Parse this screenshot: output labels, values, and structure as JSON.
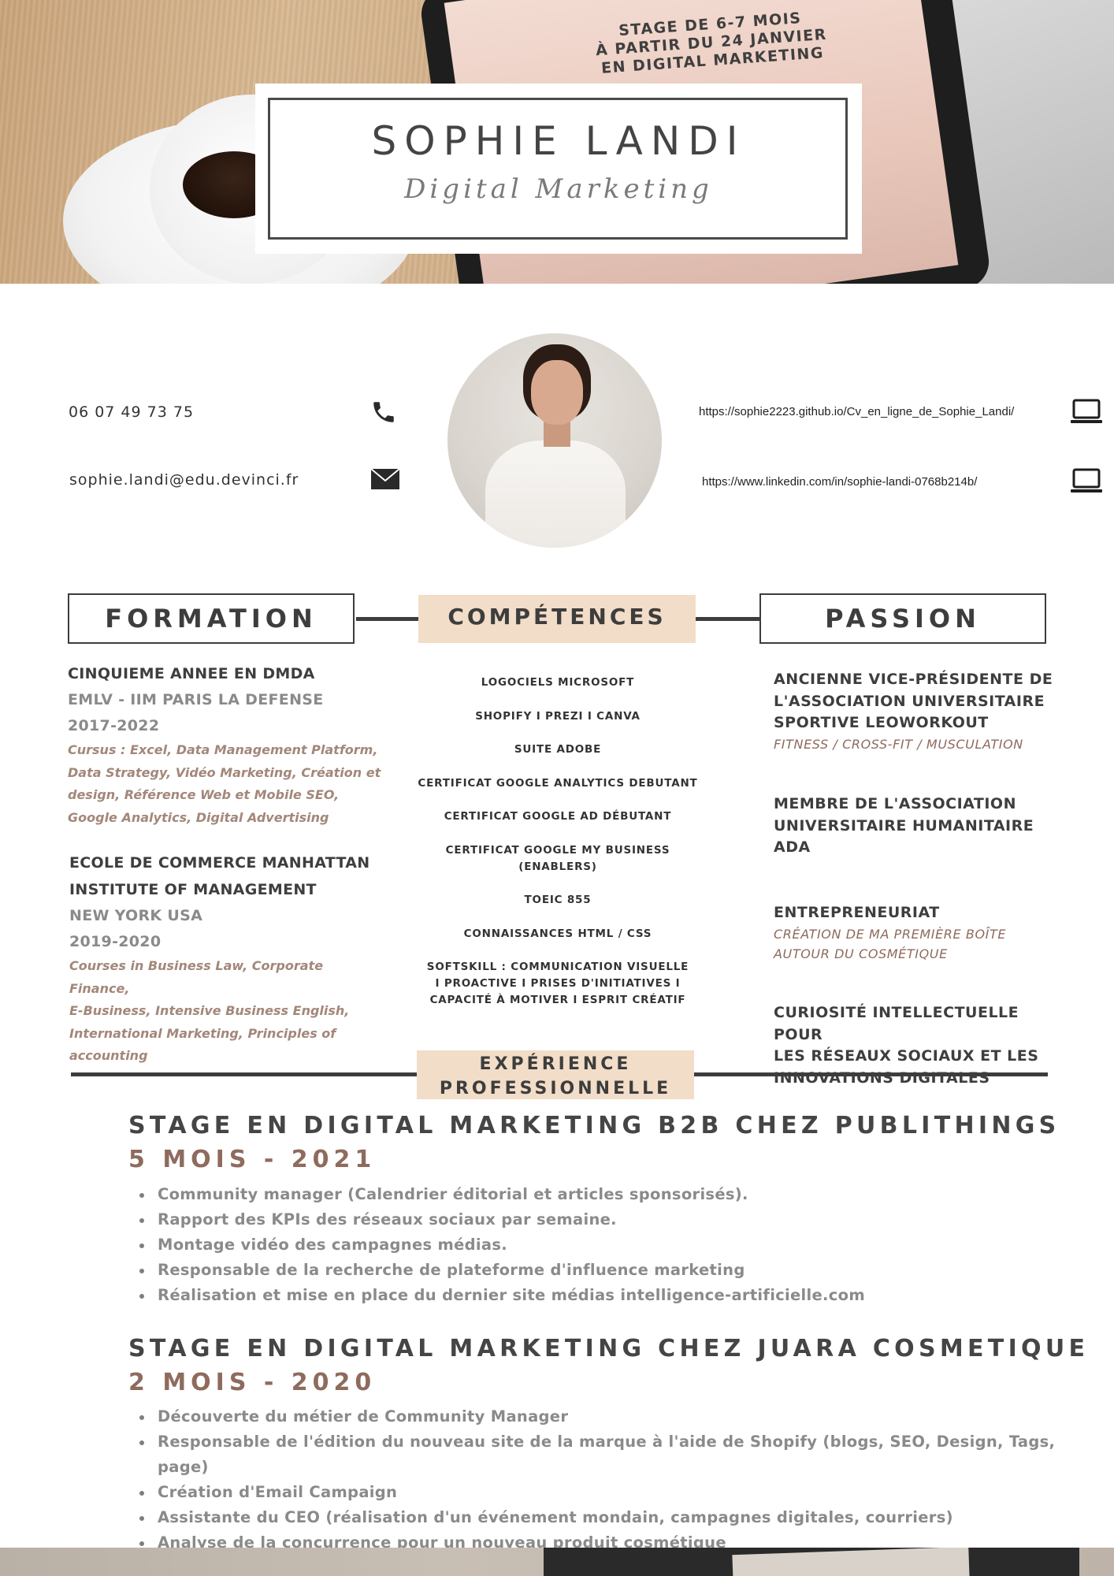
{
  "header": {
    "name": "SOPHIE LANDI",
    "title": "Digital Marketing",
    "stage_note": [
      "STAGE DE 6-7 MOIS",
      "À PARTIR DU 24 JANVIER",
      "EN DIGITAL MARKETING"
    ]
  },
  "contact": {
    "phone": "06 07 49 73 75",
    "email": "sophie.landi@edu.devinci.fr",
    "website": "https://sophie2223.github.io/Cv_en_ligne_de_Sophie_Landi/",
    "linkedin": "https://www.linkedin.com/in/sophie-landi-0768b214b/",
    "icons": {
      "phone": "phone-icon",
      "email": "envelope-icon",
      "website": "laptop-icon",
      "linkedin": "laptop-icon"
    }
  },
  "sections": {
    "formation": "FORMATION",
    "competences": "COMPÉTENCES",
    "passion": "PASSION",
    "experience": [
      "EXPÉRIENCE",
      "PROFESSIONNELLE"
    ]
  },
  "formation": [
    {
      "degree": "CINQUIEME ANNEE EN DMDA",
      "school": "EMLV - IIM PARIS LA DEFENSE",
      "years": "2017-2022",
      "desc": [
        "Cursus : Excel, Data Management Platform,",
        "Data Strategy, Vidéo Marketing, Création et",
        "design, Référence Web et Mobile SEO,",
        "Google Analytics, Digital Advertising"
      ]
    },
    {
      "degree": [
        "ECOLE DE COMMERCE MANHATTAN",
        "INSTITUTE OF MANAGEMENT"
      ],
      "school": "NEW YORK USA",
      "years": "2019-2020",
      "desc": [
        "Courses in Business Law, Corporate Finance,",
        "E-Business, Intensive Business English,",
        "International Marketing, Principles of",
        "accounting"
      ]
    }
  ],
  "competences": [
    "LOGOCIELS MICROSOFT",
    "SHOPIFY I PREZI I CANVA",
    "SUITE ADOBE",
    "CERTIFICAT GOOGLE ANALYTICS DEBUTANT",
    "CERTIFICAT GOOGLE AD DÉBUTANT",
    [
      "CERTIFICAT GOOGLE MY BUSINESS",
      "(ENABLERS)"
    ],
    "TOEIC 855",
    "CONNAISSANCES HTML / CSS",
    [
      "SOFTSKILL : COMMUNICATION VISUELLE",
      "I PROACTIVE I PRISES D'INITIATIVES I",
      "CAPACITÉ À MOTIVER I ESPRIT CRÉATIF"
    ]
  ],
  "passion": [
    {
      "title": [
        "ANCIENNE VICE-PRÉSIDENTE DE",
        "L'ASSOCIATION UNIVERSITAIRE",
        "SPORTIVE LEOWORKOUT"
      ],
      "sub": [
        "FITNESS / CROSS-FIT / MUSCULATION"
      ]
    },
    {
      "title": [
        "MEMBRE DE L'ASSOCIATION",
        "UNIVERSITAIRE HUMANITAIRE",
        "ADA"
      ],
      "sub": []
    },
    {
      "title": [
        "ENTREPRENEURIAT"
      ],
      "sub": [
        "CRÉATION DE MA PREMIÈRE BOÎTE",
        "AUTOUR DU COSMÉTIQUE"
      ]
    },
    {
      "title": [
        "CURIOSITÉ INTELLECTUELLE POUR",
        "LES RÉSEAUX SOCIAUX ET LES",
        "INNOVATIONS DIGITALES"
      ],
      "sub": []
    }
  ],
  "experience": [
    {
      "title": "STAGE EN DIGITAL MARKETING B2B CHEZ PUBLITHINGS",
      "duration": "5 MOIS - 2021",
      "items": [
        "Community manager (Calendrier éditorial et articles sponsorisés).",
        "Rapport des KPIs des réseaux sociaux par semaine.",
        "Montage vidéo des campagnes médias.",
        "Responsable de la recherche de plateforme d'influence marketing",
        "Réalisation et mise en place du dernier site médias intelligence-artificielle.com"
      ]
    },
    {
      "title": "STAGE EN DIGITAL MARKETING CHEZ JUARA COSMETIQUE",
      "duration": "2 MOIS - 2020",
      "items": [
        "Découverte du métier de Community Manager",
        "Responsable de l'édition du nouveau site de la marque à l'aide de Shopify (blogs, SEO, Design, Tags, page)",
        "Création d'Email Campaign",
        "Assistante du CEO (réalisation d'un événement mondain, campagnes digitales, courriers)",
        "Analyse de la concurrence pour un nouveau produit cosmétique"
      ]
    }
  ],
  "colors": {
    "accent_fill": "#f2ddc8",
    "text_dark": "#3d3d3d",
    "brown": "#8e6b5d",
    "grey": "#8a8a8a"
  }
}
